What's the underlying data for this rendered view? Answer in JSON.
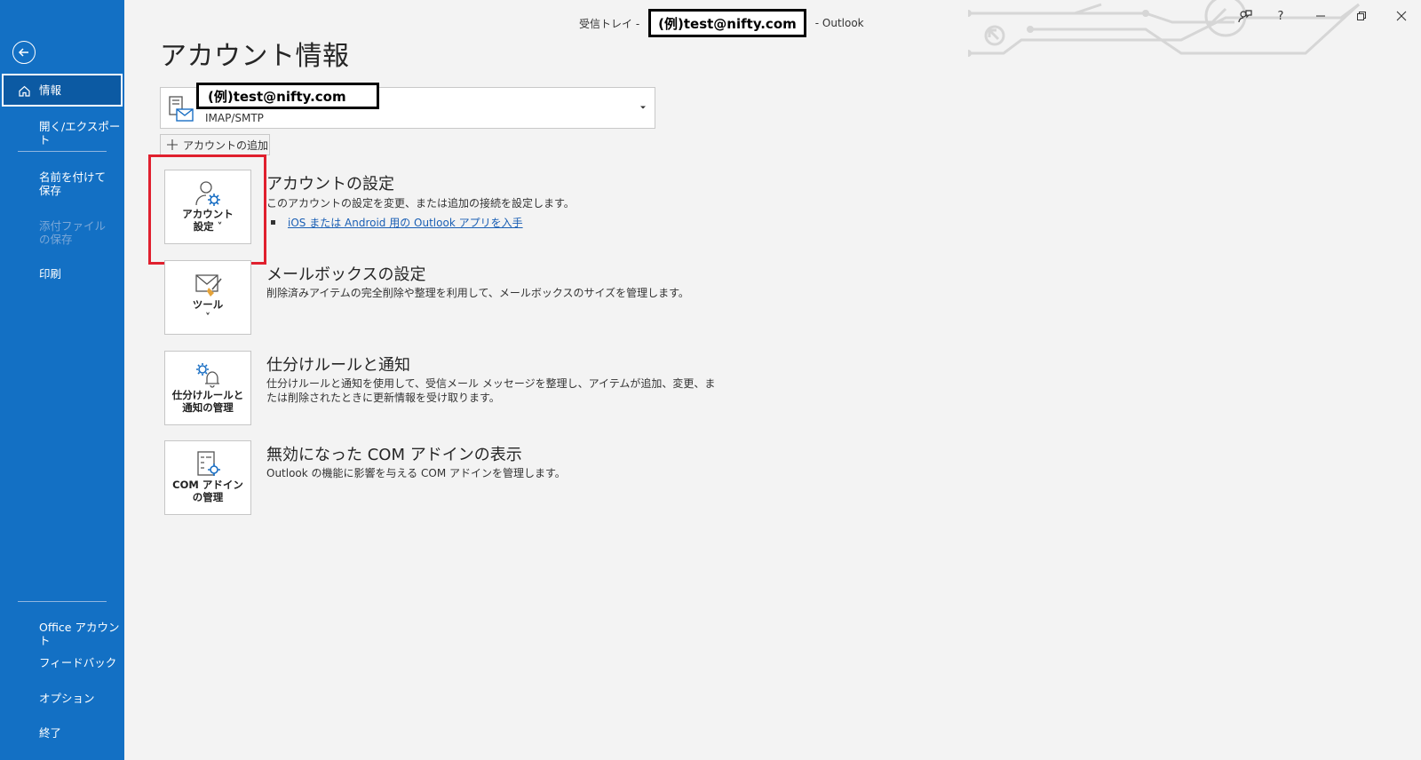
{
  "titlebar": {
    "prefix": "受信トレイ -",
    "account": "(例)test@nifty.com",
    "suffix": "- Outlook"
  },
  "window_controls": {
    "help_label": "?"
  },
  "sidebar": {
    "items": [
      {
        "label": "情報"
      },
      {
        "label": "開く/エクスポート"
      },
      {
        "label": "名前を付けて保存"
      },
      {
        "label": "添付ファイルの保存"
      },
      {
        "label": "印刷"
      },
      {
        "label": "Office アカウント"
      },
      {
        "label": "フィードバック"
      },
      {
        "label": "オプション"
      },
      {
        "label": "終了"
      }
    ]
  },
  "main": {
    "title": "アカウント情報",
    "account": {
      "email": "(例)test@nifty.com",
      "type": "IMAP/SMTP"
    },
    "add_account_label": "アカウントの追加",
    "sections": [
      {
        "tile_line1": "アカウント",
        "tile_line2": "設定 ˅",
        "title": "アカウントの設定",
        "desc": "このアカウントの設定を変更、または追加の接続を設定します。",
        "link": "iOS または Android 用の Outlook アプリを入手"
      },
      {
        "tile_line1": "ツール",
        "tile_line2": "˅",
        "title": "メールボックスの設定",
        "desc": "削除済みアイテムの完全削除や整理を利用して、メールボックスのサイズを管理します。"
      },
      {
        "tile_line1": "仕分けルールと",
        "tile_line2": "通知の管理",
        "title": "仕分けルールと通知",
        "desc1": "仕分けルールと通知を使用して、受信メール メッセージを整理し、アイテムが追加、変更、ま",
        "desc2": "たは削除されたときに更新情報を受け取ります。"
      },
      {
        "tile_line1": "COM アドイン",
        "tile_line2": "の管理",
        "title": "無効になった COM アドインの表示",
        "desc": "Outlook の機能に影響を与える COM アドインを管理します。"
      }
    ]
  },
  "colors": {
    "sidebar": "#1370c4",
    "highlight": "#e0202e",
    "link": "#1a5fb4"
  }
}
